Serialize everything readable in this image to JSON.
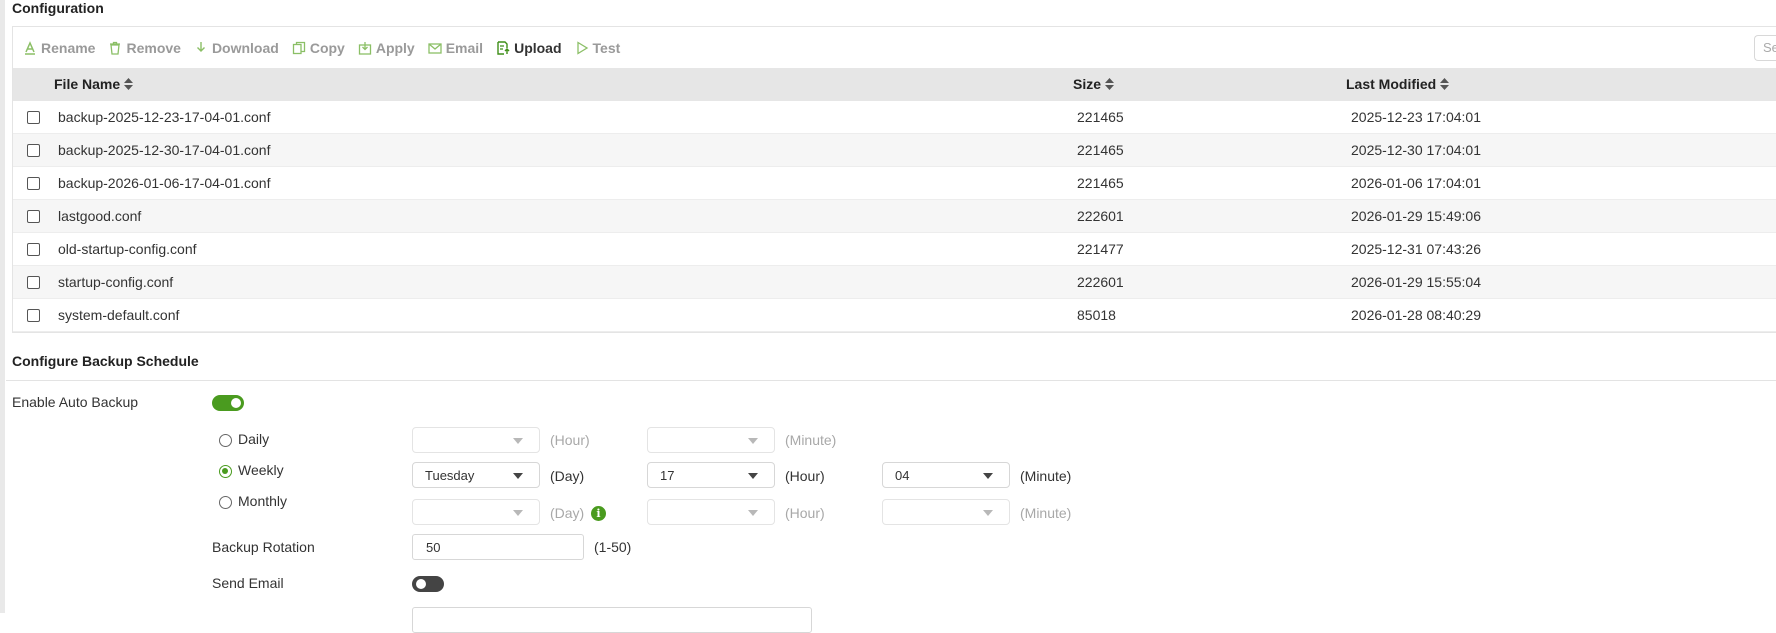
{
  "configuration": {
    "title": "Configuration",
    "toolbar": {
      "rename": "Rename",
      "remove": "Remove",
      "download": "Download",
      "copy": "Copy",
      "apply": "Apply",
      "email": "Email",
      "upload": "Upload",
      "test": "Test"
    },
    "search_placeholder": "Se",
    "columns": {
      "file_name": "File Name",
      "size": "Size",
      "last_modified": "Last Modified"
    },
    "rows": [
      {
        "name": "backup-2025-12-23-17-04-01.conf",
        "size": "221465",
        "modified": "2025-12-23 17:04:01"
      },
      {
        "name": "backup-2025-12-30-17-04-01.conf",
        "size": "221465",
        "modified": "2025-12-30 17:04:01"
      },
      {
        "name": "backup-2026-01-06-17-04-01.conf",
        "size": "221465",
        "modified": "2026-01-06 17:04:01"
      },
      {
        "name": "lastgood.conf",
        "size": "222601",
        "modified": "2026-01-29 15:49:06"
      },
      {
        "name": "old-startup-config.conf",
        "size": "221477",
        "modified": "2025-12-31 07:43:26"
      },
      {
        "name": "startup-config.conf",
        "size": "222601",
        "modified": "2026-01-29 15:55:04"
      },
      {
        "name": "system-default.conf",
        "size": "85018",
        "modified": "2026-01-28 08:40:29"
      }
    ]
  },
  "schedule": {
    "title": "Configure Backup Schedule",
    "enable_label": "Enable Auto Backup",
    "enable_on": true,
    "daily": {
      "label": "Daily",
      "hour_unit": "(Hour)",
      "minute_unit": "(Minute)"
    },
    "weekly": {
      "label": "Weekly",
      "day_value": "Tuesday",
      "day_unit": "(Day)",
      "hour_value": "17",
      "hour_unit": "(Hour)",
      "minute_value": "04",
      "minute_unit": "(Minute)"
    },
    "monthly": {
      "label": "Monthly",
      "day_unit": "(Day)",
      "hour_unit": "(Hour)",
      "minute_unit": "(Minute)"
    },
    "selected_frequency": "Weekly",
    "rotation_label": "Backup Rotation",
    "rotation_value": "50",
    "rotation_range": "(1-50)",
    "send_email_label": "Send Email",
    "send_email_on": false
  },
  "colors": {
    "accent": "#4a9b1f",
    "header_bg": "#e6e6e6"
  }
}
